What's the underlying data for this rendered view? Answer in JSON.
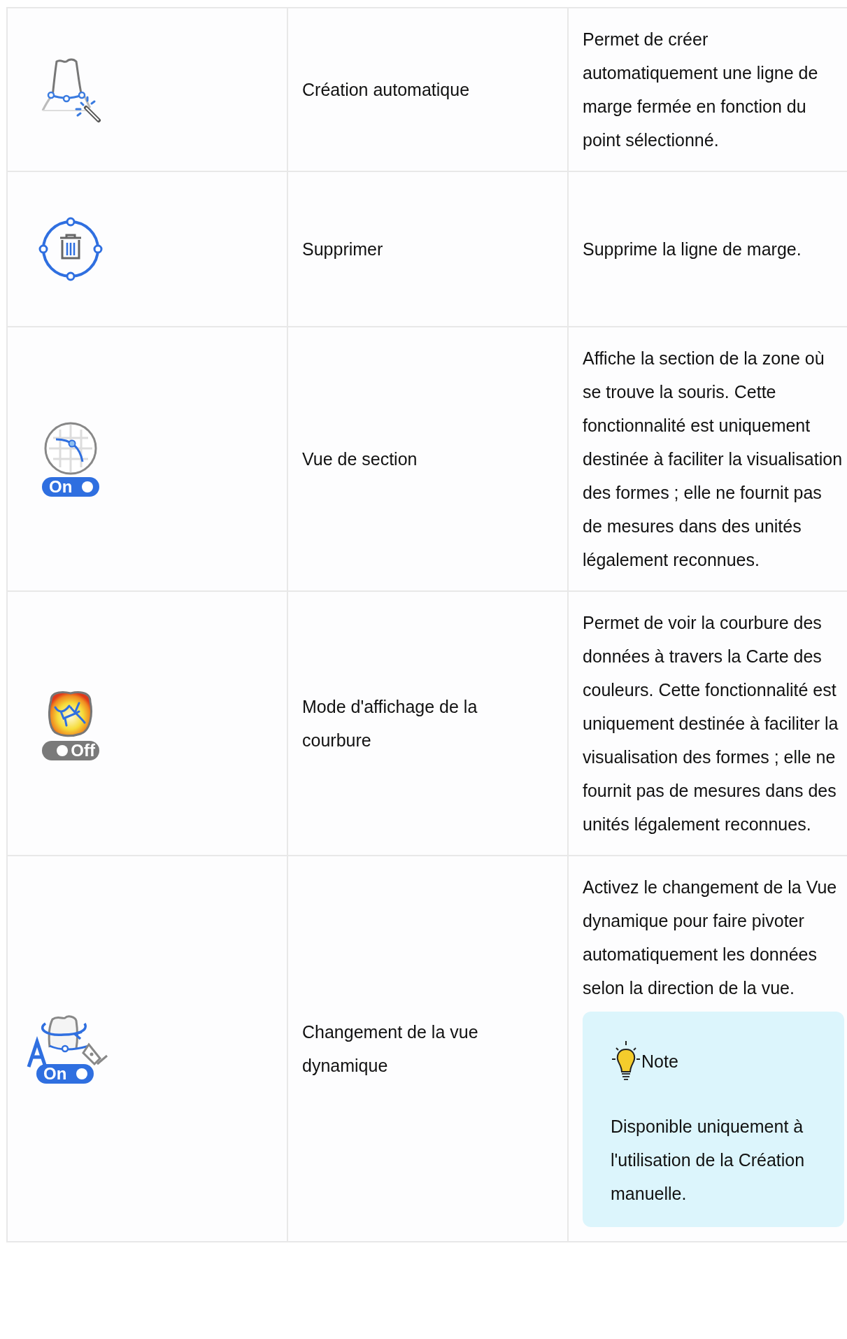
{
  "rows": [
    {
      "kind": "auto-margin",
      "name": "Création automatique",
      "description": "Permet de créer automatiquement une ligne de marge fermée en fonction du point sélectionné."
    },
    {
      "kind": "delete",
      "name": "Supprimer",
      "description": "Supprime la ligne de marge."
    },
    {
      "kind": "section",
      "toggle": {
        "label": "On",
        "on": true
      },
      "name": "Vue de section",
      "description": "Affiche la section de la zone où se trouve la souris. Cette fonctionnalité est uniquement destinée à faciliter la visualisation des formes ; elle ne fournit pas de mesures dans des unités légalement reconnues."
    },
    {
      "kind": "curvature",
      "toggle": {
        "label": "Off",
        "on": false
      },
      "name": "Mode d'affichage de la courbure",
      "description": "Permet de voir la courbure des données à travers la Carte des couleurs. Cette fonctionnalité est uniquement destinée à faciliter la visualisation des formes ; elle ne fournit pas de mesures dans des unités légalement reconnues."
    },
    {
      "kind": "dynamic-view",
      "toggle": {
        "label": "On",
        "on": true
      },
      "name": "Changement de la vue dynamique",
      "description": "Activez le changement de la Vue dynamique pour faire pivoter automatiquement les données selon la direction de la vue.",
      "note": {
        "title": "Note",
        "text": "Disponible uniquement à l'utilisation de la Création manuelle."
      }
    }
  ]
}
